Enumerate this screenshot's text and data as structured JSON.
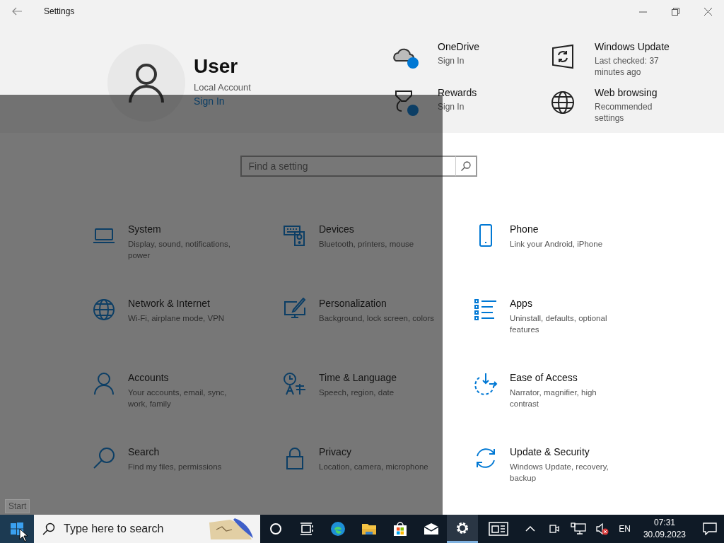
{
  "window": {
    "title": "Settings"
  },
  "account": {
    "name": "User",
    "type": "Local Account",
    "link": "Sign In"
  },
  "quick_links": [
    {
      "kind": "onedrive",
      "title": "OneDrive",
      "subtitle": "Sign In"
    },
    {
      "kind": "windows-update",
      "title": "Windows Update",
      "subtitle": "Last checked: 37 minutes ago"
    },
    {
      "kind": "rewards",
      "title": "Rewards",
      "subtitle": "Sign In"
    },
    {
      "kind": "web-browsing",
      "title": "Web browsing",
      "subtitle": "Recommended settings"
    }
  ],
  "search": {
    "placeholder": "Find a setting"
  },
  "categories": [
    {
      "kind": "system",
      "title": "System",
      "subtitle": "Display, sound, notifications, power"
    },
    {
      "kind": "devices",
      "title": "Devices",
      "subtitle": "Bluetooth, printers, mouse"
    },
    {
      "kind": "phone",
      "title": "Phone",
      "subtitle": "Link your Android, iPhone"
    },
    {
      "kind": "network",
      "title": "Network & Internet",
      "subtitle": "Wi-Fi, airplane mode, VPN"
    },
    {
      "kind": "personalization",
      "title": "Personalization",
      "subtitle": "Background, lock screen, colors"
    },
    {
      "kind": "apps",
      "title": "Apps",
      "subtitle": "Uninstall, defaults, optional features"
    },
    {
      "kind": "accounts",
      "title": "Accounts",
      "subtitle": "Your accounts, email, sync, work, family"
    },
    {
      "kind": "time",
      "title": "Time & Language",
      "subtitle": "Speech, region, date"
    },
    {
      "kind": "ease",
      "title": "Ease of Access",
      "subtitle": "Narrator, magnifier, high contrast"
    },
    {
      "kind": "search",
      "title": "Search",
      "subtitle": "Find my files, permissions"
    },
    {
      "kind": "privacy",
      "title": "Privacy",
      "subtitle": "Location, camera, microphone"
    },
    {
      "kind": "update",
      "title": "Update & Security",
      "subtitle": "Windows Update, recovery, backup"
    }
  ],
  "start_tooltip": "Start",
  "taskbar": {
    "search_placeholder": "Type here to search",
    "apps": [
      {
        "kind": "cortana",
        "selected": false
      },
      {
        "kind": "task-view",
        "selected": false
      },
      {
        "kind": "edge",
        "selected": false
      },
      {
        "kind": "explorer",
        "selected": false
      },
      {
        "kind": "store",
        "selected": false
      },
      {
        "kind": "mail",
        "selected": false
      },
      {
        "kind": "settings",
        "selected": true
      }
    ],
    "language": "EN",
    "time": "07:31",
    "date": "30.09.2023"
  }
}
